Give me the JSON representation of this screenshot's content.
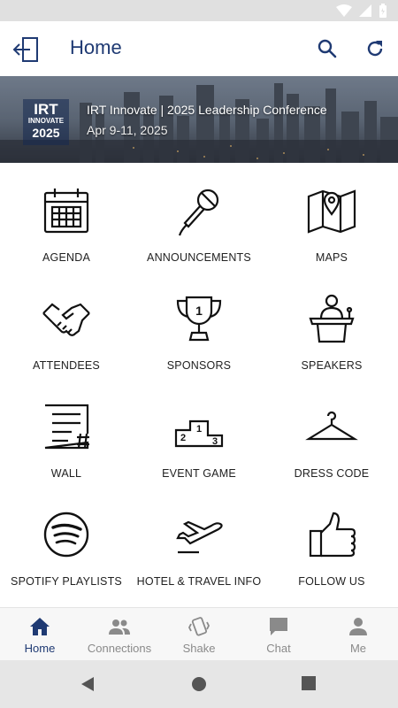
{
  "app_bar": {
    "title": "Home",
    "icons": [
      "exit-icon",
      "search-icon",
      "refresh-icon"
    ]
  },
  "banner": {
    "logo_lines": [
      "IRT",
      "INNOVATE",
      "2025"
    ],
    "title": "IRT Innovate | 2025 Leadership Conference",
    "dates": "Apr 9-11, 2025"
  },
  "tiles": [
    {
      "label": "AGENDA",
      "icon": "calendar-icon"
    },
    {
      "label": "ANNOUNCEMENTS",
      "icon": "microphone-icon"
    },
    {
      "label": "MAPS",
      "icon": "map-icon"
    },
    {
      "label": "ATTENDEES",
      "icon": "handshake-icon"
    },
    {
      "label": "SPONSORS",
      "icon": "trophy-icon"
    },
    {
      "label": "SPEAKERS",
      "icon": "podium-speaker-icon"
    },
    {
      "label": "WALL",
      "icon": "wall-post-icon"
    },
    {
      "label": "EVENT GAME",
      "icon": "winners-podium-icon"
    },
    {
      "label": "DRESS CODE",
      "icon": "hanger-icon"
    },
    {
      "label": "SPOTIFY PLAYLISTS",
      "icon": "spotify-icon"
    },
    {
      "label": "HOTEL & TRAVEL INFO",
      "icon": "airplane-icon"
    },
    {
      "label": "FOLLOW US",
      "icon": "thumbs-up-icon"
    }
  ],
  "bottom_nav": [
    {
      "label": "Home",
      "icon": "home-icon",
      "active": true
    },
    {
      "label": "Connections",
      "icon": "people-icon",
      "active": false
    },
    {
      "label": "Shake",
      "icon": "shake-icon",
      "active": false
    },
    {
      "label": "Chat",
      "icon": "chat-icon",
      "active": false
    },
    {
      "label": "Me",
      "icon": "person-icon",
      "active": false
    }
  ],
  "colors": {
    "brand": "#1f3a73",
    "nav_inactive": "#8a8a8a",
    "status_bar": "#e0e0e0"
  }
}
